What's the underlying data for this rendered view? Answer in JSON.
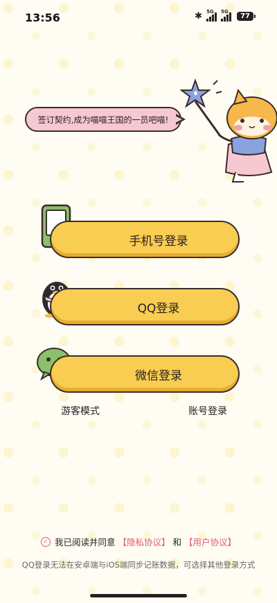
{
  "status_bar": {
    "time": "13:56",
    "signal1_label": "5G",
    "signal2_label": "5G",
    "battery": "77"
  },
  "bubble": {
    "text": "签订契约,成为喵喵王国的一员吧喵!"
  },
  "login_buttons": {
    "phone": "手机号登录",
    "qq": "QQ登录",
    "wechat": "微信登录"
  },
  "links": {
    "guest": "游客模式",
    "account": "账号登录"
  },
  "agreement": {
    "prefix": "我已阅读并同意",
    "privacy": "【隐私协议】",
    "and": "和",
    "user": "【用户协议】"
  },
  "notice": "QQ登录无法在安卓端与iOS端同步记账数据，可选择其他登录方式",
  "colors": {
    "button_fill": "#f9cd52",
    "bubble_fill": "#f6c9d2",
    "accent_link": "#e05a6e",
    "background": "#fffdf3"
  },
  "icons": {
    "bluetooth": "bluetooth-icon",
    "phone": "phone-icon",
    "qq": "qq-penguin-icon",
    "wechat": "wechat-icon",
    "check": "check-circle-icon"
  }
}
